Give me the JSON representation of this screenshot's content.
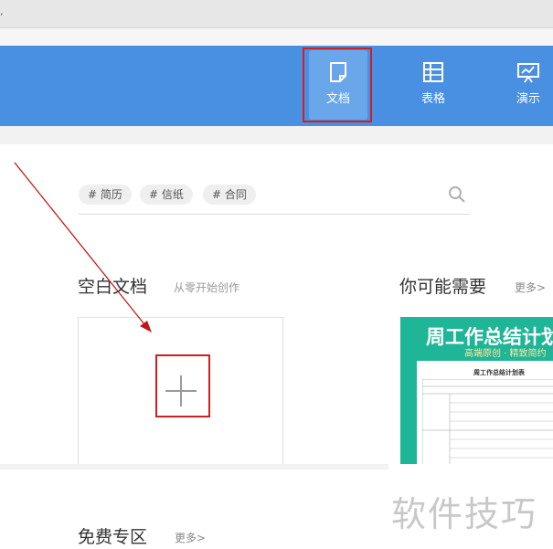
{
  "topbar": {
    "glyph": ","
  },
  "nav": {
    "items": [
      {
        "label": "文档",
        "icon": "document-icon",
        "active": true
      },
      {
        "label": "表格",
        "icon": "spreadsheet-icon",
        "active": false
      },
      {
        "label": "演示",
        "icon": "presentation-icon",
        "active": false
      }
    ]
  },
  "search": {
    "tags": [
      "# 简历",
      "# 信纸",
      "# 合同"
    ],
    "icon": "search-icon"
  },
  "blank_section": {
    "title": "空白文档",
    "subtitle": "从零开始创作",
    "plus_icon": "plus-icon"
  },
  "recommend_section": {
    "title": "你可能需要",
    "more": "更多>",
    "template": {
      "title": "周工作总结计划",
      "subtitle": "高端原创 · 精致简约",
      "paper_title": "周工作总结计划表"
    }
  },
  "free_section": {
    "title": "免费专区",
    "more": "更多>"
  },
  "watermark": "软件技巧",
  "colors": {
    "brand_blue": "#4a90e2",
    "highlight_red": "#d01f1f",
    "template_green": "#1fb597"
  }
}
